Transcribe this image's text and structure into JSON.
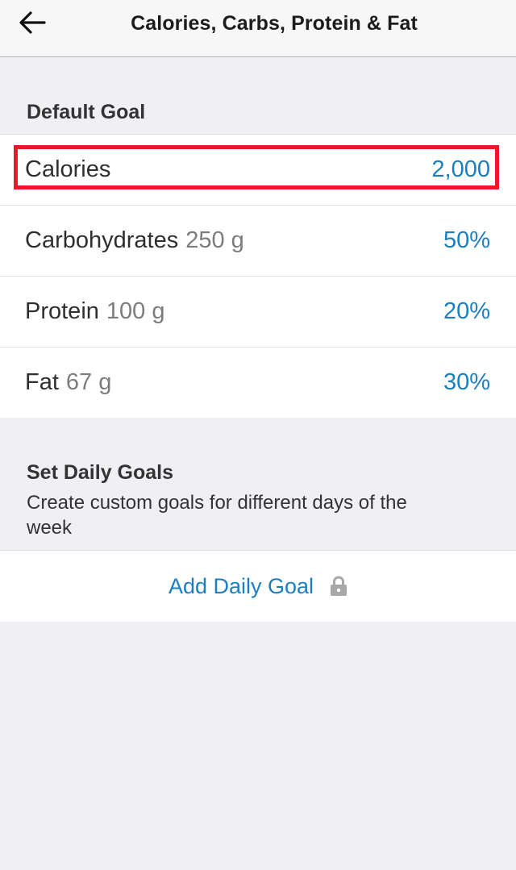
{
  "header": {
    "title": "Calories, Carbs, Protein & Fat",
    "back_icon": "arrow-left-icon"
  },
  "default_goal": {
    "section_title": "Default Goal",
    "rows": [
      {
        "label": "Calories",
        "sub": "",
        "value": "2,000"
      },
      {
        "label": "Carbohydrates",
        "sub": "250 g",
        "value": "50%"
      },
      {
        "label": "Protein",
        "sub": "100 g",
        "value": "20%"
      },
      {
        "label": "Fat",
        "sub": "67 g",
        "value": "30%"
      }
    ]
  },
  "daily_goals": {
    "section_title": "Set Daily Goals",
    "description": "Create custom goals for different days of the week",
    "add_label": "Add Daily Goal",
    "add_icon": "lock-icon"
  },
  "colors": {
    "accent": "#1a7fc1",
    "highlight": "#e8192c",
    "background": "#efeff4"
  }
}
